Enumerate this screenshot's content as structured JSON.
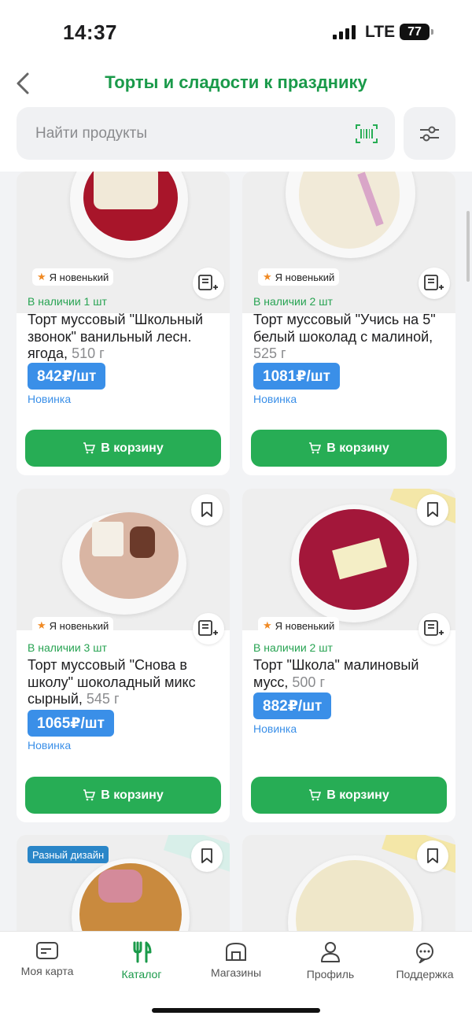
{
  "status_bar": {
    "time": "14:37",
    "network": "LTE",
    "battery": "77"
  },
  "header": {
    "title": "Торты и сладости к празднику"
  },
  "search": {
    "placeholder": "Найти продукты"
  },
  "products": [
    {
      "badge": "Я новенький",
      "stock": "В наличии 1 шт",
      "name": "Торт муссовый \"Школьный звонок\" ванильный лесн. ягода,",
      "weight": "510 г",
      "price": "842₽/шт",
      "tag": "Новинка",
      "cart_label": "В корзину",
      "cake_colors": {
        "plate": "#f7f7f7",
        "cake": "#a8152a",
        "top": "#c91e3a"
      }
    },
    {
      "badge": "Я новенький",
      "stock": "В наличии 2 шт",
      "name": "Торт муссовый \"Учись на 5\" белый шоколад с малиной,",
      "weight": "525 г",
      "price": "1081₽/шт",
      "tag": "Новинка",
      "cart_label": "В корзину",
      "cake_colors": {
        "plate": "#f4f4f4",
        "cake": "#f1ead8",
        "top": "#f6f0e2"
      }
    },
    {
      "badge": "Я новенький",
      "stock": "В наличии 3 шт",
      "name": "Торт муссовый \"Снова в школу\" шоколадный микс сырный,",
      "weight": "545 г",
      "price": "1065₽/шт",
      "tag": "Новинка",
      "cart_label": "В корзину",
      "cake_colors": {
        "plate": "#f7f7f7",
        "cake": "#d9b5a3",
        "top": "#e3c2b1"
      }
    },
    {
      "badge": "Я новенький",
      "stock": "В наличии 2 шт",
      "name": "Торт \"Школа\" малиновый мусс,",
      "weight": "500 г",
      "price": "882₽/шт",
      "tag": "Новинка",
      "cart_label": "В корзину",
      "cake_colors": {
        "plate": "#f4f4f4",
        "cake": "#8e1230",
        "top": "#a3173a"
      }
    },
    {
      "design_badge": "Разный дизайн",
      "cake_colors": {
        "plate": "#f7f7f7",
        "cake": "#c98a3e",
        "top": "#d99a4a"
      }
    },
    {
      "cake_colors": {
        "plate": "#f4f4f4",
        "cake": "#efe7c9",
        "top": "#f4edd2"
      }
    }
  ],
  "tabs": [
    {
      "label": "Моя карта",
      "icon": "card-icon",
      "active": false
    },
    {
      "label": "Каталог",
      "icon": "cutlery-icon",
      "active": true
    },
    {
      "label": "Магазины",
      "icon": "store-icon",
      "active": false
    },
    {
      "label": "Профиль",
      "icon": "profile-icon",
      "active": false
    },
    {
      "label": "Поддержка",
      "icon": "support-icon",
      "active": false
    }
  ],
  "colors": {
    "accent_green": "#1a9a4a",
    "cart_green": "#27ad55",
    "price_blue": "#3a8fe8",
    "stock_green": "#27a352"
  }
}
